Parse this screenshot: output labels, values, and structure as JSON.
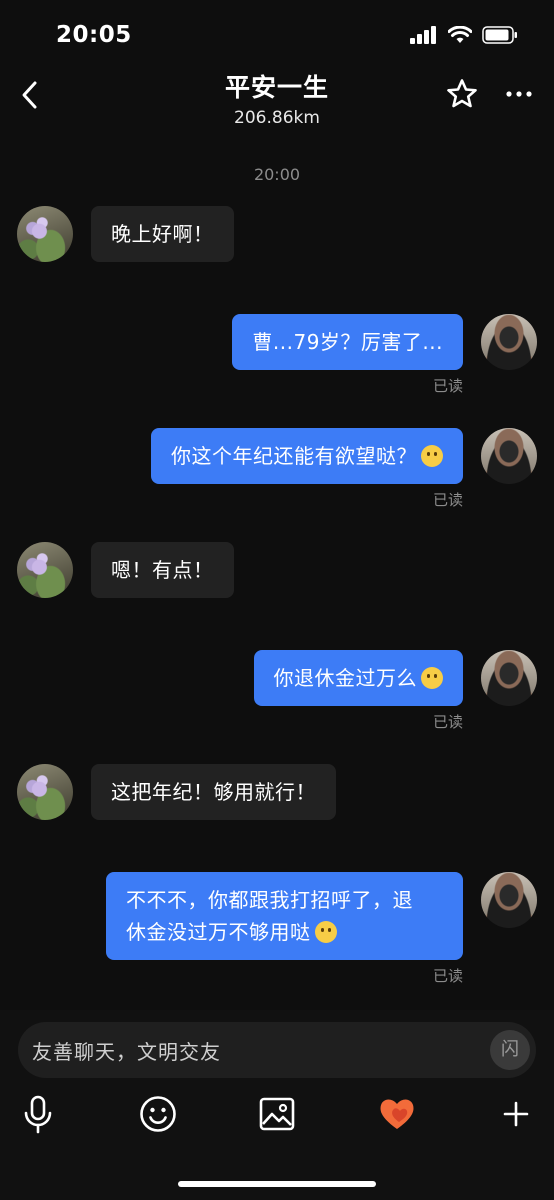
{
  "status_bar": {
    "time": "20:05"
  },
  "header": {
    "title": "平安一生",
    "subtitle": "206.86km"
  },
  "chat": {
    "timestamp": "20:00",
    "messages": [
      {
        "from": "other",
        "text": "晚上好啊！"
      },
      {
        "from": "self",
        "text": "曹...79岁？厉害了...",
        "status": "已读"
      },
      {
        "from": "self",
        "text": "你这个年纪还能有欲望哒？",
        "emoji": "emoji",
        "status": "已读"
      },
      {
        "from": "other",
        "text": "嗯！有点！"
      },
      {
        "from": "self",
        "text": "你退休金过万么",
        "emoji": "emoji",
        "status": "已读"
      },
      {
        "from": "other",
        "text": "这把年纪！够用就行！"
      },
      {
        "from": "self",
        "text_line1": "不不不，你都跟我打招呼了，退",
        "text_line2": "休金没过万不够用哒",
        "emoji": "emoji",
        "status": "已读"
      }
    ]
  },
  "input": {
    "placeholder": "友善聊天，文明交友",
    "flash_label": "闪"
  },
  "icons": {
    "back": "chevron-left-icon",
    "favorite": "star-icon",
    "more": "more-icon",
    "voice": "microphone-icon",
    "emoji": "smiley-icon",
    "image": "image-icon",
    "heart": "heart-icon",
    "plus": "plus-icon"
  },
  "colors": {
    "background": "#0e0e0e",
    "self_bubble": "#3d7cf6",
    "other_bubble": "#222222",
    "heart": "#f26b3a"
  }
}
